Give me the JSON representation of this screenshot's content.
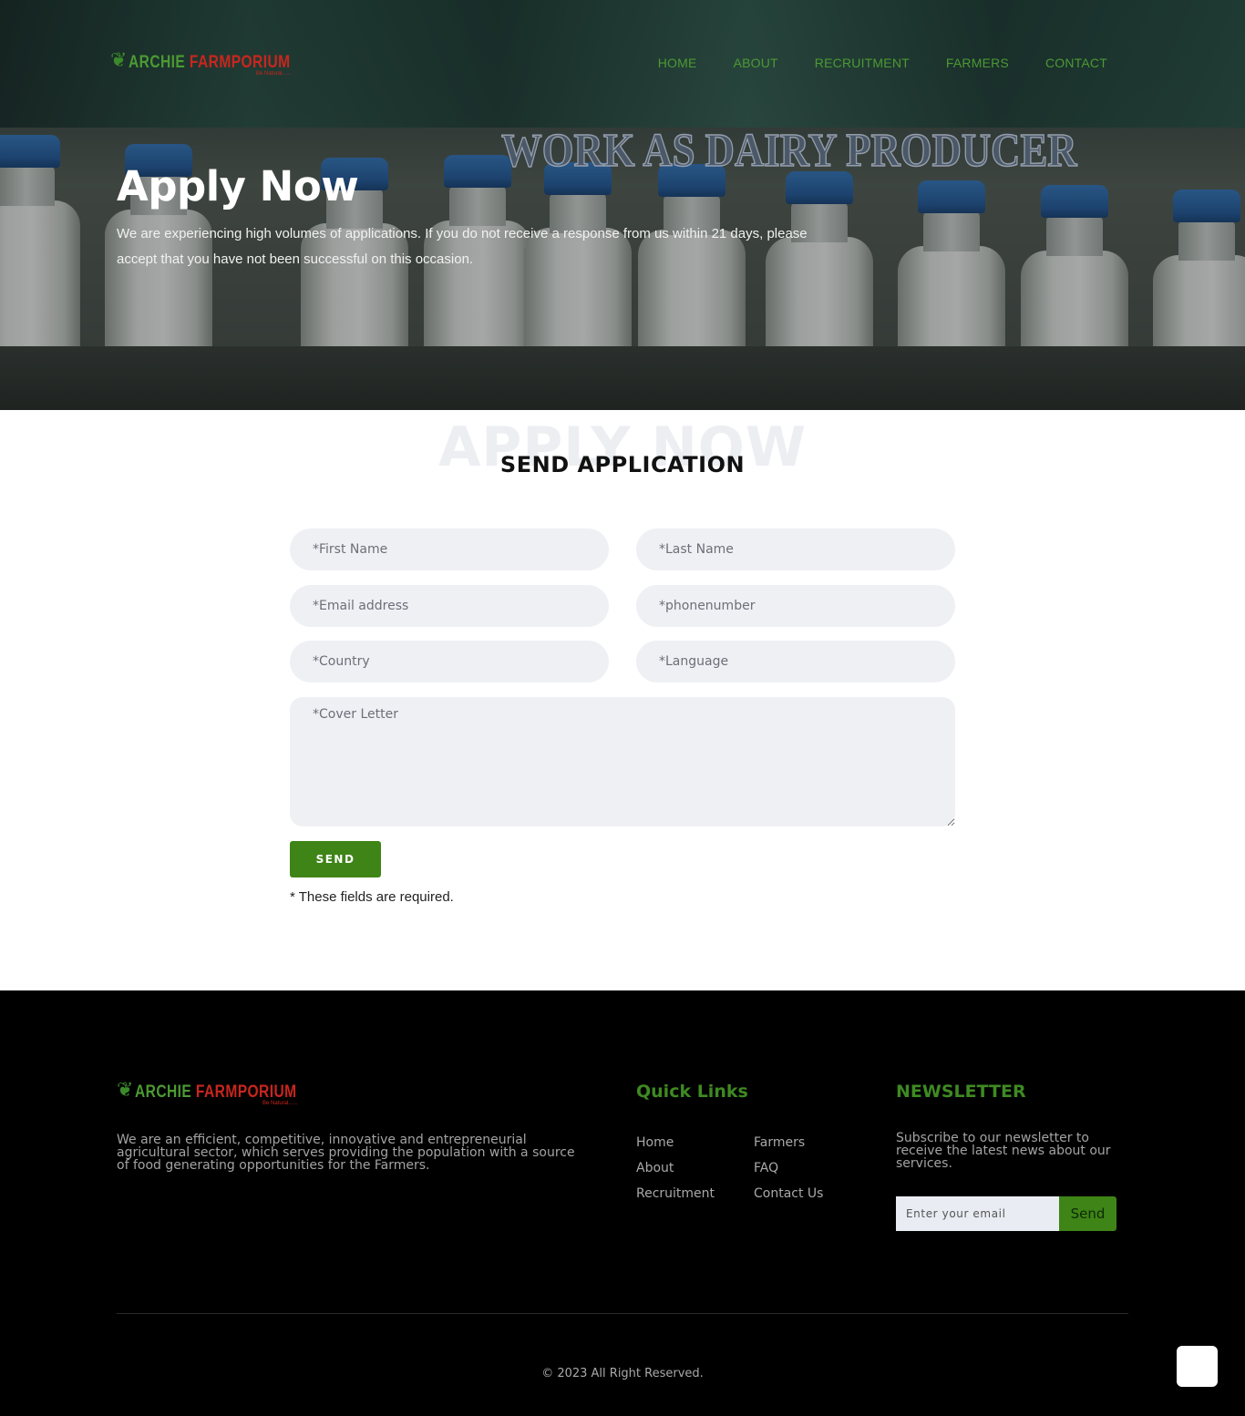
{
  "brand": {
    "logo_part1": "ARCHIE",
    "logo_part2": "FARMPORIUM",
    "logo_tagline": "Be Natural......",
    "colors": {
      "green": "#4c9a33",
      "red": "#c8261e",
      "button_green": "#3e8416"
    }
  },
  "nav": {
    "items": [
      {
        "label": "HOME"
      },
      {
        "label": "ABOUT"
      },
      {
        "label": "RECRUITMENT"
      },
      {
        "label": "FARMERS"
      },
      {
        "label": "CONTACT"
      }
    ]
  },
  "hero": {
    "watermark": "WORK AS DAIRY PRODUCER",
    "title": "Apply Now",
    "text": "We are experiencing high volumes of applications. If you do not receive a response from us within 21 days, please accept that you have not been successful on this occasion."
  },
  "form": {
    "watermark": "APPLY NOW",
    "title": "SEND APPLICATION",
    "first_name_placeholder": "*First Name",
    "last_name_placeholder": "*Last Name",
    "email_placeholder": "*Email address",
    "phone_placeholder": "*phonenumber",
    "country_placeholder": "*Country",
    "language_placeholder": "*Language",
    "cover_letter_placeholder": "*Cover Letter",
    "send_label": "SEND",
    "required_note": "* These fields are required."
  },
  "footer": {
    "about": "We are an efficient, competitive, innovative and entrepreneurial agricultural sector, which serves providing the population with a source of food generating opportunities for the Farmers.",
    "quick_links_title": "Quick Links",
    "links": [
      "Home",
      "About",
      "Recruitment",
      "Farmers",
      "FAQ",
      "Contact Us"
    ],
    "newsletter_title": "NEWSLETTER",
    "newsletter_text": "Subscribe to our newsletter to receive the latest news about our services.",
    "email_placeholder": "Enter your email",
    "send_label": "Send",
    "copyright": "© 2023 All Right Reserved."
  }
}
